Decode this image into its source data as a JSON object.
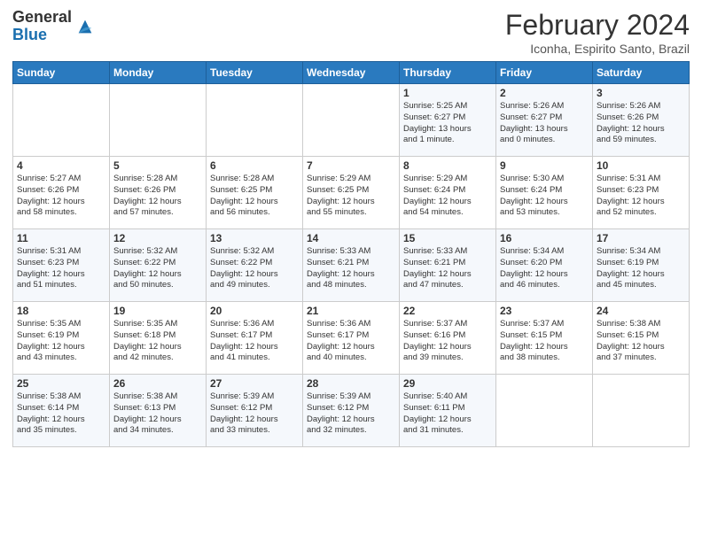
{
  "header": {
    "logo_general": "General",
    "logo_blue": "Blue",
    "month_title": "February 2024",
    "subtitle": "Iconha, Espirito Santo, Brazil"
  },
  "weekdays": [
    "Sunday",
    "Monday",
    "Tuesday",
    "Wednesday",
    "Thursday",
    "Friday",
    "Saturday"
  ],
  "weeks": [
    [
      {
        "day": "",
        "info": ""
      },
      {
        "day": "",
        "info": ""
      },
      {
        "day": "",
        "info": ""
      },
      {
        "day": "",
        "info": ""
      },
      {
        "day": "1",
        "info": "Sunrise: 5:25 AM\nSunset: 6:27 PM\nDaylight: 13 hours\nand 1 minute."
      },
      {
        "day": "2",
        "info": "Sunrise: 5:26 AM\nSunset: 6:27 PM\nDaylight: 13 hours\nand 0 minutes."
      },
      {
        "day": "3",
        "info": "Sunrise: 5:26 AM\nSunset: 6:26 PM\nDaylight: 12 hours\nand 59 minutes."
      }
    ],
    [
      {
        "day": "4",
        "info": "Sunrise: 5:27 AM\nSunset: 6:26 PM\nDaylight: 12 hours\nand 58 minutes."
      },
      {
        "day": "5",
        "info": "Sunrise: 5:28 AM\nSunset: 6:26 PM\nDaylight: 12 hours\nand 57 minutes."
      },
      {
        "day": "6",
        "info": "Sunrise: 5:28 AM\nSunset: 6:25 PM\nDaylight: 12 hours\nand 56 minutes."
      },
      {
        "day": "7",
        "info": "Sunrise: 5:29 AM\nSunset: 6:25 PM\nDaylight: 12 hours\nand 55 minutes."
      },
      {
        "day": "8",
        "info": "Sunrise: 5:29 AM\nSunset: 6:24 PM\nDaylight: 12 hours\nand 54 minutes."
      },
      {
        "day": "9",
        "info": "Sunrise: 5:30 AM\nSunset: 6:24 PM\nDaylight: 12 hours\nand 53 minutes."
      },
      {
        "day": "10",
        "info": "Sunrise: 5:31 AM\nSunset: 6:23 PM\nDaylight: 12 hours\nand 52 minutes."
      }
    ],
    [
      {
        "day": "11",
        "info": "Sunrise: 5:31 AM\nSunset: 6:23 PM\nDaylight: 12 hours\nand 51 minutes."
      },
      {
        "day": "12",
        "info": "Sunrise: 5:32 AM\nSunset: 6:22 PM\nDaylight: 12 hours\nand 50 minutes."
      },
      {
        "day": "13",
        "info": "Sunrise: 5:32 AM\nSunset: 6:22 PM\nDaylight: 12 hours\nand 49 minutes."
      },
      {
        "day": "14",
        "info": "Sunrise: 5:33 AM\nSunset: 6:21 PM\nDaylight: 12 hours\nand 48 minutes."
      },
      {
        "day": "15",
        "info": "Sunrise: 5:33 AM\nSunset: 6:21 PM\nDaylight: 12 hours\nand 47 minutes."
      },
      {
        "day": "16",
        "info": "Sunrise: 5:34 AM\nSunset: 6:20 PM\nDaylight: 12 hours\nand 46 minutes."
      },
      {
        "day": "17",
        "info": "Sunrise: 5:34 AM\nSunset: 6:19 PM\nDaylight: 12 hours\nand 45 minutes."
      }
    ],
    [
      {
        "day": "18",
        "info": "Sunrise: 5:35 AM\nSunset: 6:19 PM\nDaylight: 12 hours\nand 43 minutes."
      },
      {
        "day": "19",
        "info": "Sunrise: 5:35 AM\nSunset: 6:18 PM\nDaylight: 12 hours\nand 42 minutes."
      },
      {
        "day": "20",
        "info": "Sunrise: 5:36 AM\nSunset: 6:17 PM\nDaylight: 12 hours\nand 41 minutes."
      },
      {
        "day": "21",
        "info": "Sunrise: 5:36 AM\nSunset: 6:17 PM\nDaylight: 12 hours\nand 40 minutes."
      },
      {
        "day": "22",
        "info": "Sunrise: 5:37 AM\nSunset: 6:16 PM\nDaylight: 12 hours\nand 39 minutes."
      },
      {
        "day": "23",
        "info": "Sunrise: 5:37 AM\nSunset: 6:15 PM\nDaylight: 12 hours\nand 38 minutes."
      },
      {
        "day": "24",
        "info": "Sunrise: 5:38 AM\nSunset: 6:15 PM\nDaylight: 12 hours\nand 37 minutes."
      }
    ],
    [
      {
        "day": "25",
        "info": "Sunrise: 5:38 AM\nSunset: 6:14 PM\nDaylight: 12 hours\nand 35 minutes."
      },
      {
        "day": "26",
        "info": "Sunrise: 5:38 AM\nSunset: 6:13 PM\nDaylight: 12 hours\nand 34 minutes."
      },
      {
        "day": "27",
        "info": "Sunrise: 5:39 AM\nSunset: 6:12 PM\nDaylight: 12 hours\nand 33 minutes."
      },
      {
        "day": "28",
        "info": "Sunrise: 5:39 AM\nSunset: 6:12 PM\nDaylight: 12 hours\nand 32 minutes."
      },
      {
        "day": "29",
        "info": "Sunrise: 5:40 AM\nSunset: 6:11 PM\nDaylight: 12 hours\nand 31 minutes."
      },
      {
        "day": "",
        "info": ""
      },
      {
        "day": "",
        "info": ""
      }
    ]
  ]
}
